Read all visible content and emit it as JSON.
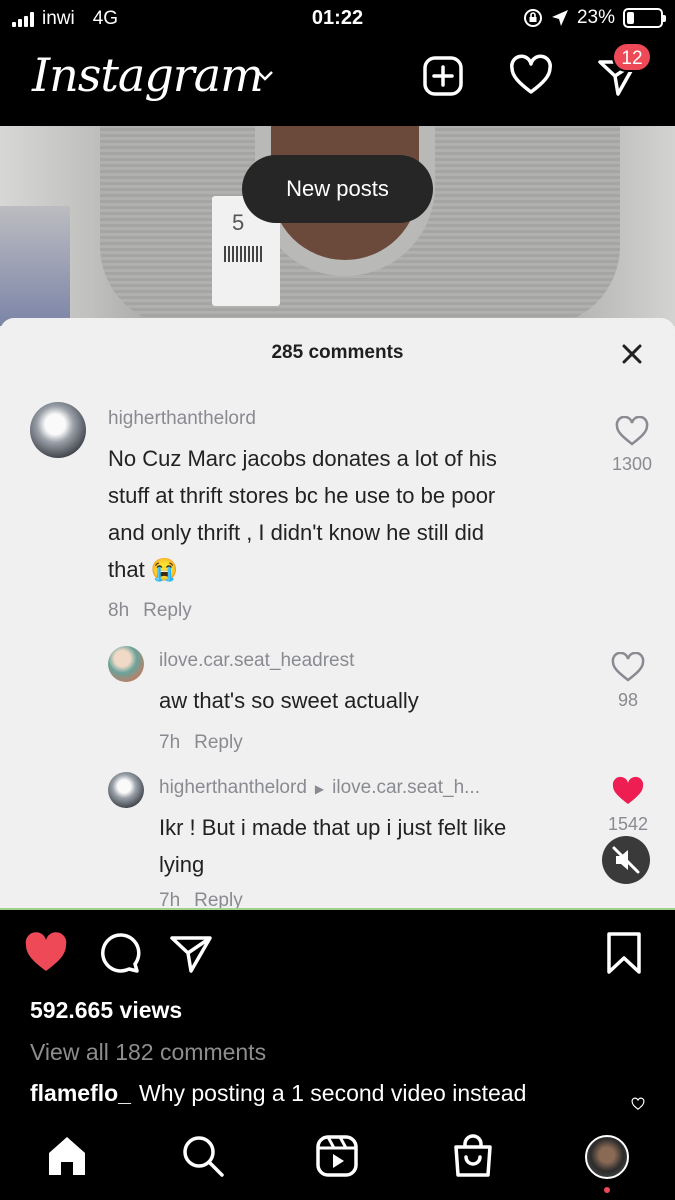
{
  "status_bar": {
    "carrier": "inwi",
    "network": "4G",
    "time": "01:22",
    "battery": "23%",
    "battery_level": 0.23
  },
  "header": {
    "logo": "Instagram",
    "dm_badge": "12"
  },
  "video": {
    "new_posts_label": "New posts",
    "comments_sheet": {
      "title": "285 comments",
      "comments": [
        {
          "user": "higherthanthelord",
          "text_lines": [
            "No Cuz Marc jacobs donates a lot of his",
            "stuff at thrift stores bc he use to be poor",
            "and only thrift , I didn't know he still did",
            "that 😭"
          ],
          "time": "8h",
          "reply_label": "Reply",
          "likes": "1300",
          "liked": false
        },
        {
          "user": "ilove.car.seat_headrest",
          "text_lines": [
            "aw that's so sweet actually"
          ],
          "time": "7h",
          "reply_label": "Reply",
          "likes": "98",
          "liked": false
        },
        {
          "user": "higherthanthelord",
          "reply_to": "ilove.car.seat_h...",
          "text_lines": [
            "Ikr ! But i made that up i just felt like",
            "lying"
          ],
          "time": "7h",
          "reply_label": "Reply",
          "likes": "1542",
          "liked": true
        }
      ]
    }
  },
  "post": {
    "liked": true,
    "views": "592.665 views",
    "view_all_comments": "View all 182 comments",
    "caption_user": "flameflo_",
    "caption_text": "Why posting a 1 second video instead"
  },
  "colors": {
    "like_red": "#ed4956",
    "background": "#000000",
    "muted_text": "#8e8e8e"
  },
  "icons": {
    "header": [
      "new-post-icon",
      "activity-heart-icon",
      "direct-messages-icon"
    ],
    "actions": [
      "like-heart-icon",
      "comment-icon",
      "share-icon",
      "save-bookmark-icon"
    ],
    "nav": [
      "home-icon",
      "search-icon",
      "reels-icon",
      "shop-icon",
      "profile-avatar"
    ]
  }
}
